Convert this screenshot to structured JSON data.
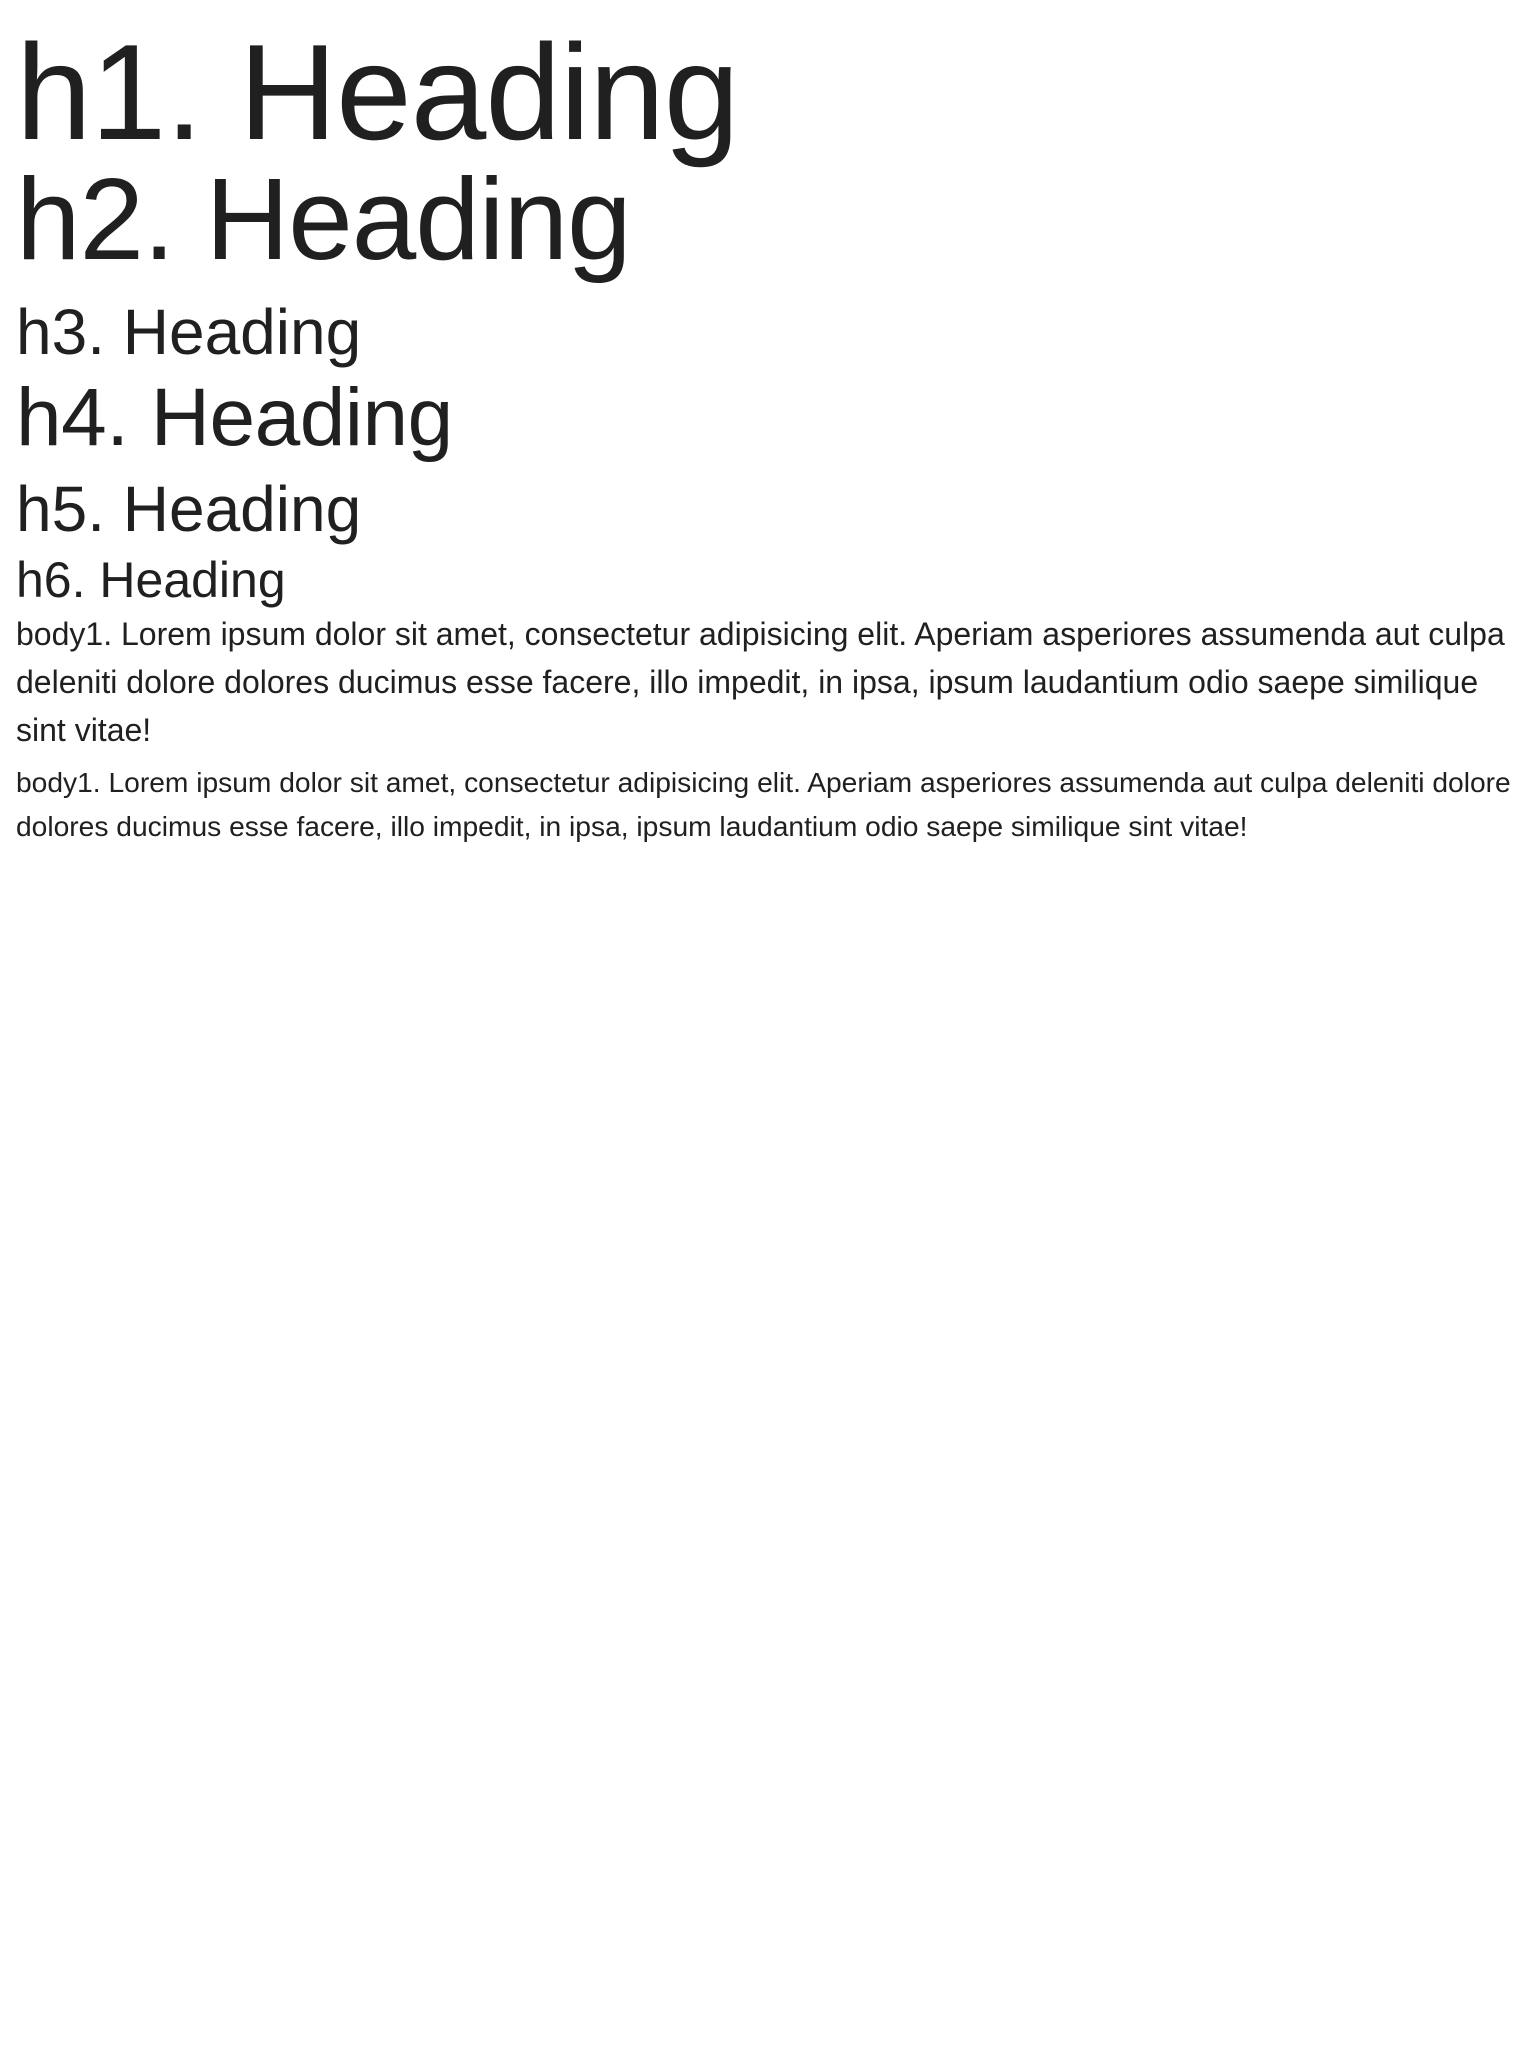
{
  "headings": {
    "h1": "h1. Heading",
    "h2": "h2. Heading",
    "h3": "h3. Heading",
    "h4": "h4. Heading",
    "h5": "h5. Heading",
    "h6": "h6. Heading"
  },
  "paragraphs": {
    "body1": "body1. Lorem ipsum dolor sit amet, consectetur adipisicing elit. Aperiam asperiores assumenda aut culpa deleniti dolore dolores ducimus esse facere, illo impedit, in ipsa, ipsum laudantium odio saepe similique sint vitae!",
    "body2": "body1. Lorem ipsum dolor sit amet, consectetur adipisicing elit. Aperiam asperiores assumenda aut culpa deleniti dolore dolores ducimus esse facere, illo impedit, in ipsa, ipsum laudantium odio saepe similique sint vitae!"
  },
  "colors": {
    "text": "#202020",
    "background": "#ffffff"
  }
}
